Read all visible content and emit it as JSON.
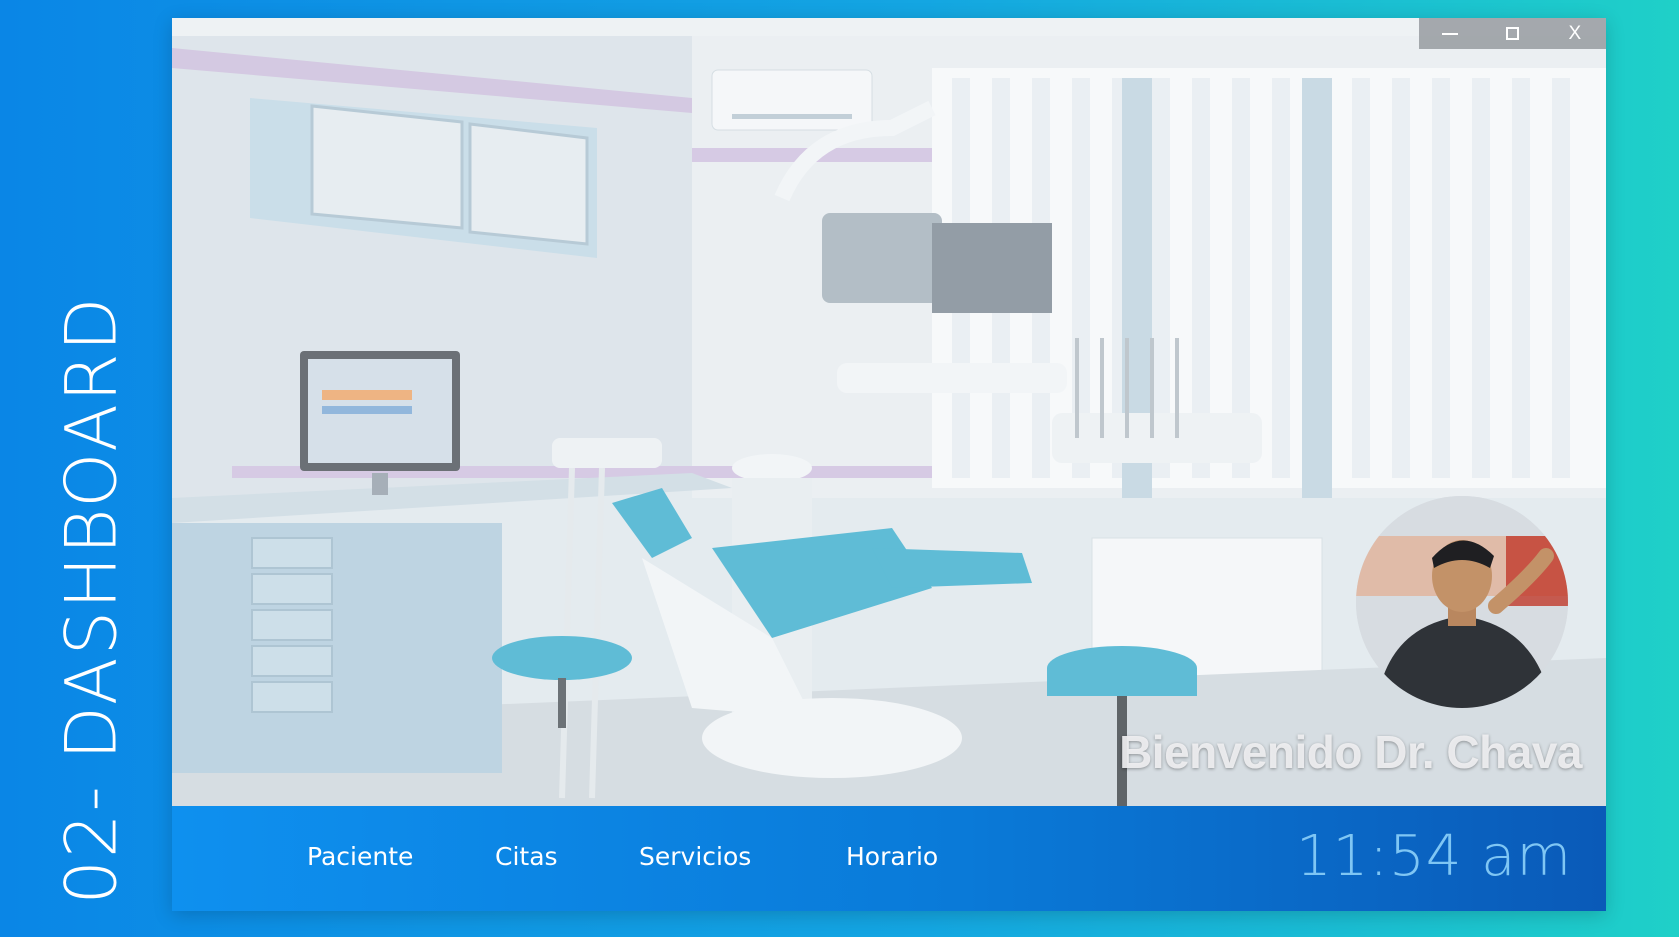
{
  "slide_label": "02- DASHBOARD",
  "window_controls": {
    "minimize_icon": "minimize-icon",
    "maximize_icon": "maximize-icon",
    "close_label": "X"
  },
  "welcome_text": "Bienvenido Dr. Chava",
  "nav": {
    "items": [
      {
        "label": "Paciente"
      },
      {
        "label": "Citas"
      },
      {
        "label": "Servicios"
      },
      {
        "label": "Horario"
      }
    ]
  },
  "clock": "11:54 am",
  "colors": {
    "nav_bar": "#0a7ad8",
    "clock_text": "#7fc6f4",
    "chair_accent": "#2aa6c8"
  }
}
